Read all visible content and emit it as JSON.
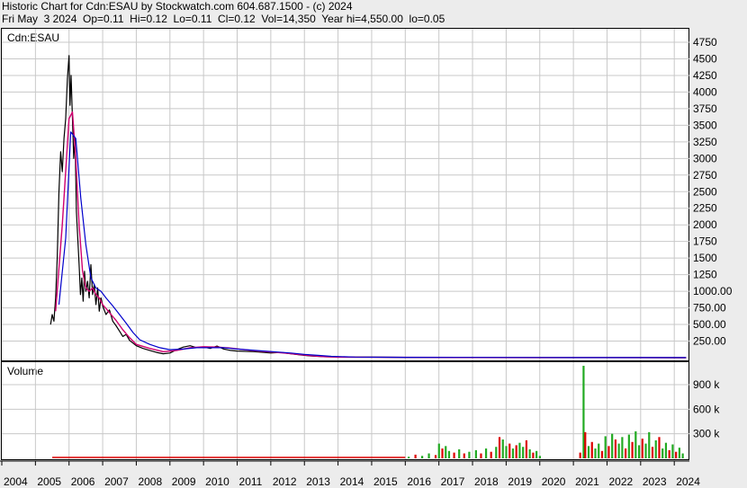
{
  "header": {
    "line1": "Historic Chart for Cdn:ESAU by Stockwatch.com 604.687.1500 - (c) 2024",
    "line2": "Fri May  3 2024  Op=0.11  Hi=0.12  Lo=0.11  Cl=0.12  Vol=14,350  Year hi=4,550.00  lo=0.05"
  },
  "colors": {
    "background": "#ececec",
    "panel": "#ffffff",
    "grid": "#c8c8c8",
    "price": "#000000",
    "ma_short": "#d0006f",
    "ma_long": "#0000cc",
    "vol_up": "#22aa22",
    "vol_down": "#dd0000"
  },
  "chart_data": [
    {
      "type": "line",
      "title": "Cdn:ESAU",
      "x_ticks": [
        "2004",
        "2005",
        "2006",
        "2007",
        "2008",
        "2009",
        "2010",
        "2011",
        "2012",
        "2013",
        "2014",
        "2015",
        "2016",
        "2017",
        "2018",
        "2019",
        "2020",
        "2021",
        "2022",
        "2023",
        "2024"
      ],
      "y_ticks": [
        "4750",
        "4500",
        "4250",
        "4000",
        "3750",
        "3500",
        "3250",
        "3000",
        "2750",
        "2500",
        "2250",
        "2000",
        "1750",
        "1500",
        "1250",
        "1000.00",
        "750.00",
        "500.00",
        "250.00"
      ],
      "y_tick_values": [
        4750,
        4500,
        4250,
        4000,
        3750,
        3500,
        3250,
        3000,
        2750,
        2500,
        2250,
        2000,
        1750,
        1500,
        1250,
        1000,
        750,
        500,
        250
      ],
      "ylim": [
        0,
        4900
      ],
      "grid": true,
      "series": [
        {
          "role": "price",
          "x": [
            2005.45,
            2005.5,
            2005.55,
            2005.6,
            2005.65,
            2005.7,
            2005.75,
            2005.8,
            2005.85,
            2005.9,
            2005.95,
            2006.0,
            2006.03,
            2006.06,
            2006.1,
            2006.14,
            2006.18,
            2006.22,
            2006.26,
            2006.3,
            2006.34,
            2006.38,
            2006.42,
            2006.46,
            2006.5,
            2006.55,
            2006.6,
            2006.65,
            2006.7,
            2006.75,
            2006.8,
            2006.85,
            2006.9,
            2006.95,
            2007.0,
            2007.1,
            2007.2,
            2007.3,
            2007.4,
            2007.5,
            2007.6,
            2007.7,
            2007.8,
            2007.9,
            2008.0,
            2008.2,
            2008.4,
            2008.6,
            2008.8,
            2009.0,
            2009.2,
            2009.4,
            2009.6,
            2009.8,
            2010.0,
            2010.2,
            2010.4,
            2010.6,
            2010.8,
            2011.0,
            2011.5,
            2012.0,
            2012.3,
            2012.6,
            2012.9,
            2013.2,
            2013.6,
            2014.0,
            2015.0,
            2016.0,
            2017.0,
            2018.0,
            2019.0,
            2020.0,
            2021.0,
            2022.0,
            2023.0,
            2024.35
          ],
          "y": [
            500,
            650,
            550,
            900,
            1500,
            2500,
            3100,
            2800,
            3300,
            3600,
            4200,
            4550,
            3800,
            4250,
            3600,
            3000,
            3300,
            2200,
            1800,
            1400,
            950,
            1200,
            850,
            1300,
            1000,
            1150,
            900,
            1400,
            950,
            1100,
            800,
            1050,
            700,
            900,
            780,
            650,
            720,
            550,
            480,
            400,
            320,
            350,
            260,
            220,
            180,
            140,
            110,
            80,
            60,
            70,
            120,
            160,
            180,
            150,
            160,
            140,
            175,
            130,
            110,
            100,
            90,
            70,
            80,
            60,
            40,
            25,
            15,
            10,
            8,
            6,
            5,
            4,
            3,
            2,
            2,
            1.5,
            1,
            0.12
          ]
        },
        {
          "role": "ma_short",
          "x": [
            2005.6,
            2005.8,
            2006.0,
            2006.1,
            2006.2,
            2006.3,
            2006.4,
            2006.5,
            2006.6,
            2006.7,
            2006.8,
            2006.9,
            2007.0,
            2007.2,
            2007.4,
            2007.6,
            2007.8,
            2008.0,
            2008.4,
            2008.8,
            2009.2,
            2009.6,
            2010.0,
            2010.4,
            2010.8,
            2011.2,
            2011.6,
            2012.0,
            2012.4,
            2012.8,
            2013.2,
            2013.6,
            2014.0,
            2016.0,
            2018.0,
            2020.0,
            2022.0,
            2024.35
          ],
          "y": [
            700,
            2000,
            3600,
            3700,
            3000,
            2000,
            1300,
            1050,
            1000,
            1050,
            950,
            900,
            800,
            680,
            560,
            420,
            300,
            200,
            140,
            90,
            110,
            150,
            165,
            160,
            145,
            120,
            100,
            85,
            70,
            50,
            30,
            15,
            8,
            5,
            3,
            2,
            1,
            0.5
          ]
        },
        {
          "role": "ma_long",
          "x": [
            2005.7,
            2005.9,
            2006.05,
            2006.2,
            2006.35,
            2006.5,
            2006.65,
            2006.8,
            2006.95,
            2007.1,
            2007.3,
            2007.5,
            2007.7,
            2007.9,
            2008.1,
            2008.4,
            2008.7,
            2009.0,
            2009.4,
            2009.8,
            2010.2,
            2010.6,
            2011.0,
            2011.4,
            2011.8,
            2012.2,
            2012.6,
            2013.0,
            2013.4,
            2013.8,
            2014.5,
            2016.0,
            2018.0,
            2020.0,
            2022.0,
            2024.35
          ],
          "y": [
            800,
            1800,
            3400,
            3300,
            2400,
            1700,
            1200,
            1050,
            1000,
            900,
            780,
            650,
            520,
            380,
            270,
            200,
            150,
            120,
            130,
            150,
            150,
            150,
            130,
            115,
            100,
            85,
            70,
            50,
            35,
            20,
            10,
            6,
            4,
            3,
            2,
            1
          ]
        }
      ]
    },
    {
      "type": "bar",
      "title": "Volume",
      "y_ticks": [
        "900 k",
        "600 k",
        "300 k"
      ],
      "y_tick_values": [
        900000,
        600000,
        300000
      ],
      "ylim": [
        0,
        1200000
      ],
      "grid": true,
      "bars": [
        {
          "x": 2016.1,
          "v": 20000,
          "up": true
        },
        {
          "x": 2016.3,
          "v": 45000,
          "up": false
        },
        {
          "x": 2016.5,
          "v": 30000,
          "up": true
        },
        {
          "x": 2016.7,
          "v": 60000,
          "up": true
        },
        {
          "x": 2016.9,
          "v": 40000,
          "up": false
        },
        {
          "x": 2017.0,
          "v": 180000,
          "up": true
        },
        {
          "x": 2017.1,
          "v": 120000,
          "up": false
        },
        {
          "x": 2017.2,
          "v": 150000,
          "up": true
        },
        {
          "x": 2017.3,
          "v": 90000,
          "up": true
        },
        {
          "x": 2017.45,
          "v": 70000,
          "up": false
        },
        {
          "x": 2017.6,
          "v": 110000,
          "up": true
        },
        {
          "x": 2017.75,
          "v": 60000,
          "up": false
        },
        {
          "x": 2017.9,
          "v": 80000,
          "up": true
        },
        {
          "x": 2018.1,
          "v": 100000,
          "up": true
        },
        {
          "x": 2018.25,
          "v": 60000,
          "up": false
        },
        {
          "x": 2018.4,
          "v": 120000,
          "up": true
        },
        {
          "x": 2018.55,
          "v": 80000,
          "up": false
        },
        {
          "x": 2018.7,
          "v": 140000,
          "up": true
        },
        {
          "x": 2018.8,
          "v": 260000,
          "up": false
        },
        {
          "x": 2018.9,
          "v": 230000,
          "up": true
        },
        {
          "x": 2019.0,
          "v": 150000,
          "up": true
        },
        {
          "x": 2019.1,
          "v": 180000,
          "up": false
        },
        {
          "x": 2019.2,
          "v": 120000,
          "up": true
        },
        {
          "x": 2019.3,
          "v": 160000,
          "up": false
        },
        {
          "x": 2019.4,
          "v": 190000,
          "up": true
        },
        {
          "x": 2019.5,
          "v": 140000,
          "up": true
        },
        {
          "x": 2019.6,
          "v": 220000,
          "up": false
        },
        {
          "x": 2019.7,
          "v": 110000,
          "up": true
        },
        {
          "x": 2019.8,
          "v": 70000,
          "up": false
        },
        {
          "x": 2019.9,
          "v": 90000,
          "up": true
        },
        {
          "x": 2020.0,
          "v": 30000,
          "up": true
        },
        {
          "x": 2021.2,
          "v": 70000,
          "up": false
        },
        {
          "x": 2021.3,
          "v": 1130000,
          "up": true
        },
        {
          "x": 2021.35,
          "v": 320000,
          "up": false
        },
        {
          "x": 2021.45,
          "v": 150000,
          "up": true
        },
        {
          "x": 2021.55,
          "v": 200000,
          "up": false
        },
        {
          "x": 2021.65,
          "v": 120000,
          "up": true
        },
        {
          "x": 2021.75,
          "v": 180000,
          "up": true
        },
        {
          "x": 2021.85,
          "v": 90000,
          "up": false
        },
        {
          "x": 2021.95,
          "v": 270000,
          "up": true
        },
        {
          "x": 2022.05,
          "v": 150000,
          "up": false
        },
        {
          "x": 2022.15,
          "v": 300000,
          "up": true
        },
        {
          "x": 2022.25,
          "v": 230000,
          "up": false
        },
        {
          "x": 2022.35,
          "v": 180000,
          "up": true
        },
        {
          "x": 2022.45,
          "v": 260000,
          "up": true
        },
        {
          "x": 2022.55,
          "v": 120000,
          "up": false
        },
        {
          "x": 2022.65,
          "v": 290000,
          "up": true
        },
        {
          "x": 2022.75,
          "v": 200000,
          "up": false
        },
        {
          "x": 2022.85,
          "v": 330000,
          "up": true
        },
        {
          "x": 2022.95,
          "v": 160000,
          "up": true
        },
        {
          "x": 2023.05,
          "v": 240000,
          "up": false
        },
        {
          "x": 2023.15,
          "v": 180000,
          "up": true
        },
        {
          "x": 2023.25,
          "v": 320000,
          "up": true
        },
        {
          "x": 2023.35,
          "v": 140000,
          "up": false
        },
        {
          "x": 2023.45,
          "v": 220000,
          "up": true
        },
        {
          "x": 2023.55,
          "v": 260000,
          "up": false
        },
        {
          "x": 2023.65,
          "v": 120000,
          "up": true
        },
        {
          "x": 2023.75,
          "v": 190000,
          "up": true
        },
        {
          "x": 2023.85,
          "v": 100000,
          "up": false
        },
        {
          "x": 2023.95,
          "v": 170000,
          "up": true
        },
        {
          "x": 2024.05,
          "v": 80000,
          "up": false
        },
        {
          "x": 2024.15,
          "v": 130000,
          "up": true
        },
        {
          "x": 2024.25,
          "v": 60000,
          "up": true
        }
      ]
    }
  ]
}
